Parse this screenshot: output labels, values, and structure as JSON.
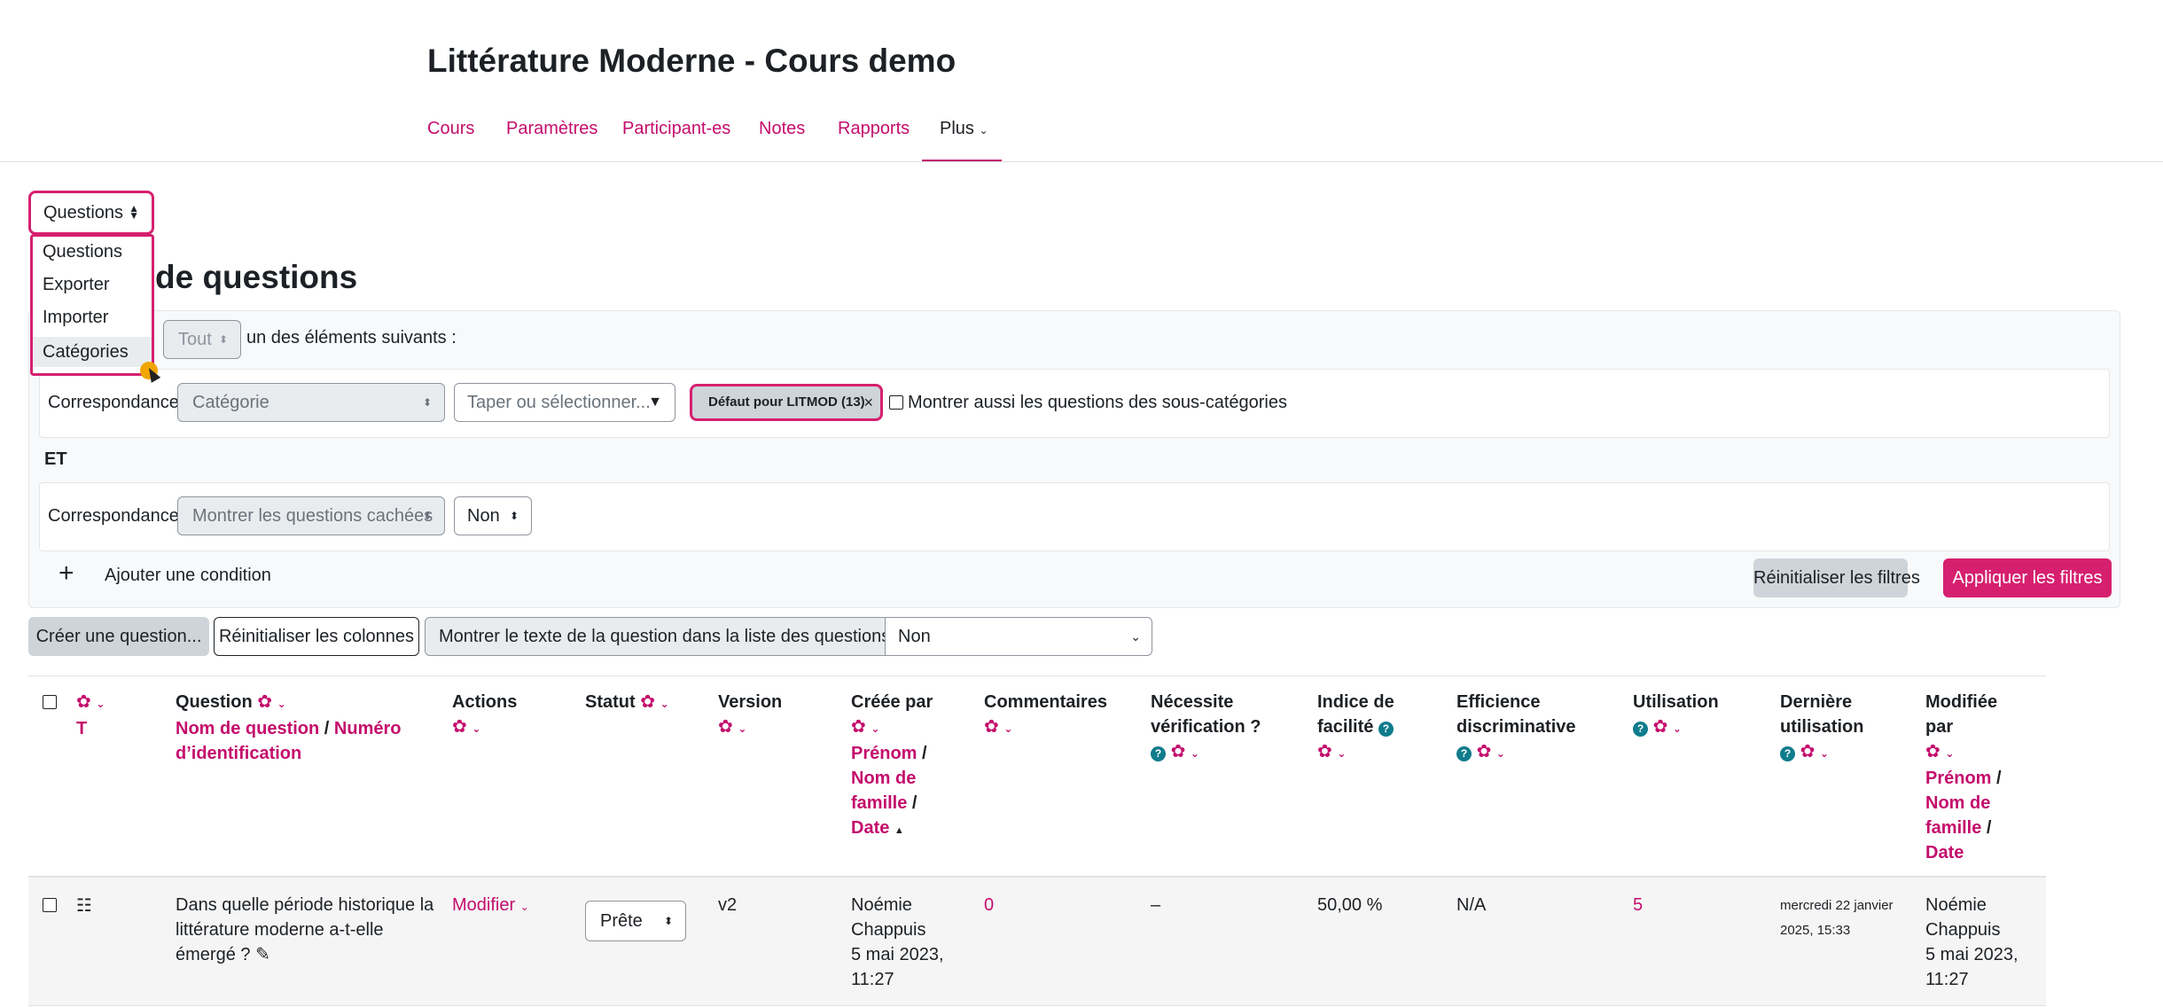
{
  "course": {
    "title": "Littérature Moderne - Cours demo",
    "nav": [
      "Cours",
      "Paramètres",
      "Participant-es",
      "Notes",
      "Rapports"
    ],
    "nav_more": "Plus"
  },
  "qnav": {
    "selected": "Questions",
    "menu": [
      "Questions",
      "Exporter",
      "Importer",
      "Catégories"
    ]
  },
  "page_title": "de questions",
  "filter": {
    "match_select": "Tout",
    "match_text": "un des éléments suivants :",
    "rows": [
      {
        "label": "Correspondance",
        "type_select": "Catégorie",
        "search_placeholder": "Taper ou sélectionner...",
        "tag": "Défaut pour LITMOD (13)",
        "tag_close": "×",
        "subcat_label": "Montrer aussi les questions des sous-catégories"
      },
      {
        "label": "Correspondance",
        "type_select": "Montrer les questions cachées",
        "value_select": "Non"
      }
    ],
    "join": "ET",
    "add_condition": "Ajouter une condition",
    "reset": "Réinitialiser les filtres",
    "apply": "Appliquer les filtres"
  },
  "toolbar": {
    "create": "Créer une question...",
    "reset_columns": "Réinitialiser les colonnes",
    "show_text_label": "Montrer le texte de la question dans la liste des questions ?",
    "show_text_value": "Non"
  },
  "table": {
    "headers": {
      "type_sort": "T",
      "question": "Question",
      "question_sort_name": "Nom de question",
      "question_sort_sep": "/",
      "question_sort_id_1": "Numéro",
      "question_sort_id_2": "d’identification",
      "actions": "Actions",
      "statut": "Statut",
      "version": "Version",
      "creee_par": "Créée par",
      "sort_firstname": "Prénom",
      "sort_lastname_1": "Nom de",
      "sort_lastname_2": "famille",
      "sort_date": "Date",
      "commentaires": "Commentaires",
      "verif_1": "Nécessite",
      "verif_2": "vérification ?",
      "facilite_1": "Indice de",
      "facilite_2": "facilité",
      "efficience_1": "Efficience",
      "efficience_2": "discriminative",
      "utilisation": "Utilisation",
      "derniere_1": "Dernière",
      "derniere_2": "utilisation",
      "modifiee_1": "Modifiée",
      "modifiee_2": "par"
    },
    "row": {
      "question_line1": "Dans quelle période historique la",
      "question_line2": "littérature moderne a-t-elle",
      "question_line3": "émergé ?",
      "action": "Modifier",
      "statut": "Prête",
      "version": "v2",
      "created_name_1": "Noémie",
      "created_name_2": "Chappuis",
      "created_date_1": "5 mai 2023,",
      "created_date_2": "11:27",
      "comments": "0",
      "verification": "–",
      "facility": "50,00 %",
      "discrimination": "N/A",
      "usage": "5",
      "last_used_1": "mercredi 22 janvier",
      "last_used_2": "2025, 15:33",
      "modified_name_1": "Noémie",
      "modified_name_2": "Chappuis",
      "modified_date_1": "5 mai 2023,",
      "modified_date_2": "11:27"
    }
  },
  "colors": {
    "accent": "#c40d6c",
    "button_primary": "#d6206f",
    "help_icon": "#0f7c8c"
  }
}
